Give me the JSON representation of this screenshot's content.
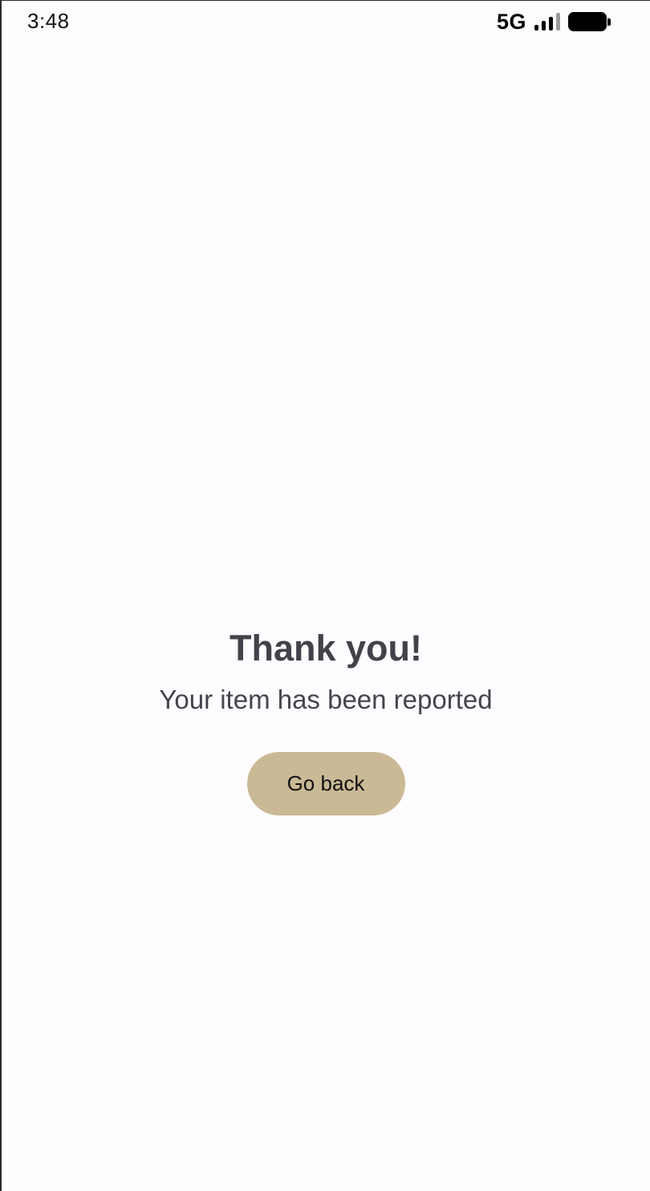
{
  "status_bar": {
    "time": "3:48",
    "network": "5G",
    "icons": [
      "signal-icon",
      "battery-icon"
    ]
  },
  "main": {
    "title": "Thank you!",
    "subtitle": "Your item has been reported",
    "button_label": "Go back"
  },
  "colors": {
    "background": "#fefcfe",
    "title_text": "#45414a",
    "button_bg": "#cab995"
  }
}
